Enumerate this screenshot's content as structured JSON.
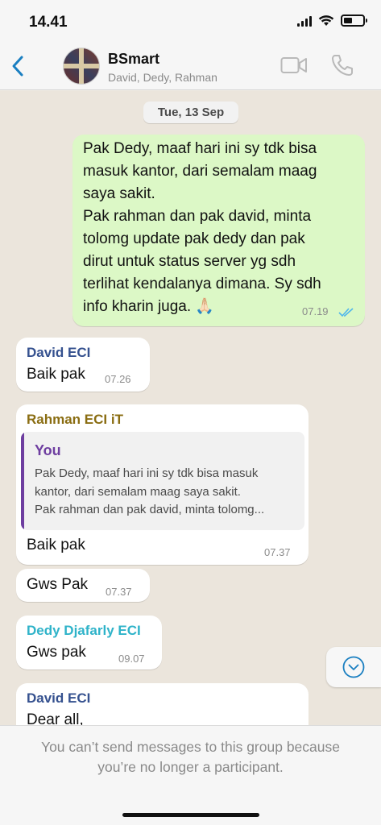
{
  "status_bar": {
    "time": "14.41"
  },
  "header": {
    "group_name": "BSmart",
    "members": "David, Dedy, Rahman",
    "accent_color": "#1a7fc1"
  },
  "chat": {
    "date_label": "Tue, 13 Sep",
    "messages": [
      {
        "direction": "out",
        "lines": [
          "Pak Dedy, maaf hari ini sy tdk bisa",
          "masuk kantor, dari semalam maag",
          "saya sakit.",
          "Pak rahman dan pak david, minta",
          "tolomg update pak dedy dan pak",
          "dirut untuk status server yg sdh",
          "terlihat kendalanya dimana. Sy sdh",
          "info kharin juga. 🙏🏻"
        ],
        "time": "07.19"
      },
      {
        "direction": "in",
        "sender": "David ECI",
        "sender_color": "#35518f",
        "text": "Baik pak",
        "time": "07.26"
      },
      {
        "direction": "in",
        "sender": "Rahman ECI iT",
        "sender_color": "#8a6d12",
        "quote_author": "You",
        "quote_author_color": "#6e3ea0",
        "quote_lines": [
          "Pak Dedy, maaf hari ini sy tdk bisa masuk",
          "kantor, dari semalam maag saya sakit.",
          "Pak rahman dan pak david, minta tolomg..."
        ],
        "text": "Baik pak",
        "time": "07.37"
      },
      {
        "direction": "in",
        "text": "Gws Pak",
        "time": "07.37"
      },
      {
        "direction": "in",
        "sender": "Dedy Djafarly ECI",
        "sender_color": "#2fb3c9",
        "text": "Gws pak",
        "time": "09.07"
      },
      {
        "direction": "in",
        "sender": "David ECI",
        "sender_color": "#35518f",
        "text": "Dear all,"
      }
    ]
  },
  "footer": {
    "note_line1": "You can’t send messages to this group because",
    "note_line2": "you’re no longer a participant."
  }
}
